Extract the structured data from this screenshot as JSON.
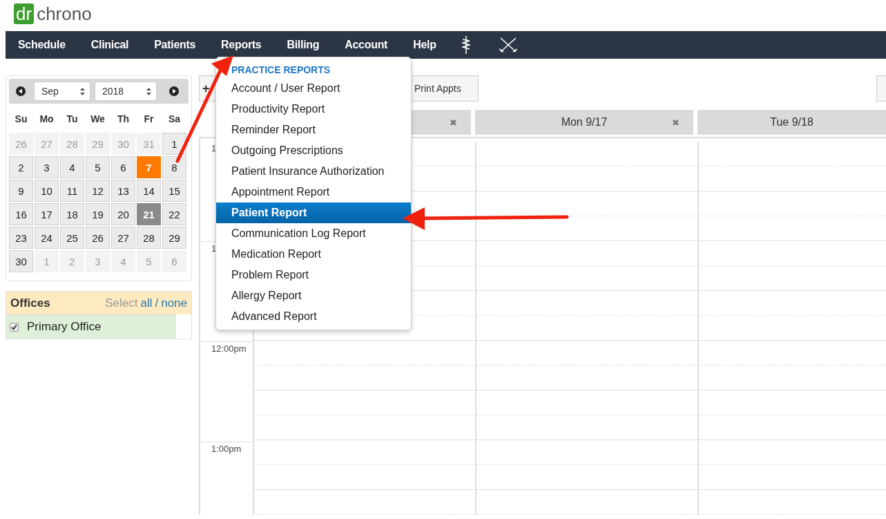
{
  "logo": {
    "mark": "dr",
    "name": "chrono"
  },
  "nav": [
    {
      "label": "Schedule"
    },
    {
      "label": "Clinical"
    },
    {
      "label": "Patients"
    },
    {
      "label": "Reports"
    },
    {
      "label": "Billing"
    },
    {
      "label": "Account"
    },
    {
      "label": "Help"
    }
  ],
  "calendar": {
    "month": "Sep",
    "year": "2018",
    "weekdays": [
      "Su",
      "Mo",
      "Tu",
      "We",
      "Th",
      "Fr",
      "Sa"
    ],
    "days": [
      {
        "label": "26",
        "kind": "outside"
      },
      {
        "label": "27",
        "kind": "outside"
      },
      {
        "label": "28",
        "kind": "outside"
      },
      {
        "label": "29",
        "kind": "outside"
      },
      {
        "label": "30",
        "kind": "outside"
      },
      {
        "label": "31",
        "kind": "outside"
      },
      {
        "label": "1",
        "kind": "day"
      },
      {
        "label": "2",
        "kind": "day"
      },
      {
        "label": "3",
        "kind": "day"
      },
      {
        "label": "4",
        "kind": "day"
      },
      {
        "label": "5",
        "kind": "day"
      },
      {
        "label": "6",
        "kind": "day"
      },
      {
        "label": "7",
        "kind": "today"
      },
      {
        "label": "8",
        "kind": "day"
      },
      {
        "label": "9",
        "kind": "day"
      },
      {
        "label": "10",
        "kind": "day"
      },
      {
        "label": "11",
        "kind": "day"
      },
      {
        "label": "12",
        "kind": "day"
      },
      {
        "label": "13",
        "kind": "day"
      },
      {
        "label": "14",
        "kind": "day"
      },
      {
        "label": "15",
        "kind": "day"
      },
      {
        "label": "16",
        "kind": "day"
      },
      {
        "label": "17",
        "kind": "day"
      },
      {
        "label": "18",
        "kind": "day"
      },
      {
        "label": "19",
        "kind": "day"
      },
      {
        "label": "20",
        "kind": "day"
      },
      {
        "label": "21",
        "kind": "selected"
      },
      {
        "label": "22",
        "kind": "day"
      },
      {
        "label": "23",
        "kind": "day"
      },
      {
        "label": "24",
        "kind": "day"
      },
      {
        "label": "25",
        "kind": "day"
      },
      {
        "label": "26",
        "kind": "day"
      },
      {
        "label": "27",
        "kind": "day"
      },
      {
        "label": "28",
        "kind": "day"
      },
      {
        "label": "29",
        "kind": "day"
      },
      {
        "label": "30",
        "kind": "day"
      },
      {
        "label": "1",
        "kind": "outside"
      },
      {
        "label": "2",
        "kind": "outside"
      },
      {
        "label": "3",
        "kind": "outside"
      },
      {
        "label": "4",
        "kind": "outside"
      },
      {
        "label": "5",
        "kind": "outside"
      },
      {
        "label": "6",
        "kind": "outside"
      }
    ]
  },
  "offices": {
    "title": "Offices",
    "select_label": "Select",
    "all_link": "all",
    "separator": "/",
    "none_link": "none",
    "items": [
      {
        "label": "Primary Office",
        "checked": true
      }
    ]
  },
  "toolbar": {
    "add_button": "+",
    "print_button": "Print Appts"
  },
  "schedule": {
    "columns": [
      {
        "close": "✖"
      },
      {
        "label": "Mon 9/17",
        "close": "✖"
      },
      {
        "label": "Tue 9/18"
      }
    ],
    "times": [
      "1",
      "1",
      "12:00pm",
      "1:00pm"
    ]
  },
  "menu": {
    "heading": "PRACTICE REPORTS",
    "items": [
      {
        "label": "Account / User Report",
        "selected": false
      },
      {
        "label": "Productivity Report",
        "selected": false
      },
      {
        "label": "Reminder Report",
        "selected": false
      },
      {
        "label": "Outgoing Prescriptions",
        "selected": false
      },
      {
        "label": "Patient Insurance Authorization",
        "selected": false
      },
      {
        "label": "Appointment Report",
        "selected": false
      },
      {
        "label": "Patient Report",
        "selected": true
      },
      {
        "label": "Communication Log Report",
        "selected": false
      },
      {
        "label": "Medication Report",
        "selected": false
      },
      {
        "label": "Problem Report",
        "selected": false
      },
      {
        "label": "Allergy Report",
        "selected": false
      },
      {
        "label": "Advanced Report",
        "selected": false
      }
    ]
  }
}
